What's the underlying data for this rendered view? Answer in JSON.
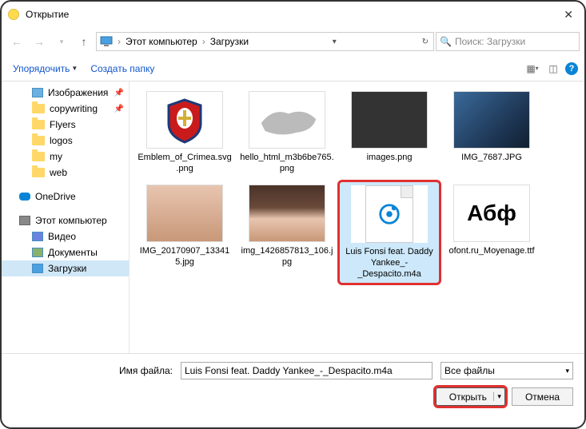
{
  "title": "Открытие",
  "breadcrumb": {
    "root": "Этот компьютер",
    "folder": "Загрузки"
  },
  "search": {
    "placeholder": "Поиск: Загрузки"
  },
  "toolbar": {
    "organize": "Упорядочить",
    "newfolder": "Создать папку"
  },
  "tree": {
    "images": "Изображения",
    "copywriting": "copywriting",
    "flyers": "Flyers",
    "logos": "logos",
    "my": "my",
    "web": "web",
    "onedrive": "OneDrive",
    "thispc": "Этот компьютер",
    "video": "Видео",
    "documents": "Документы",
    "downloads": "Загрузки"
  },
  "files": [
    {
      "name": "Emblem_of_Crimea.svg.png"
    },
    {
      "name": "hello_html_m3b6be765.png"
    },
    {
      "name": "images.png"
    },
    {
      "name": "IMG_7687.JPG"
    },
    {
      "name": "IMG_20170907_133415.jpg"
    },
    {
      "name": "img_1426857813_106.jpg"
    },
    {
      "name": "Luis Fonsi feat. Daddy Yankee_-_Despacito.m4a"
    },
    {
      "name": "ofont.ru_Moyenage.ttf"
    }
  ],
  "font_sample": "Абф",
  "bottom": {
    "label": "Имя файла:",
    "value": "Luis Fonsi feat. Daddy Yankee_-_Despacito.m4a",
    "filter": "Все файлы",
    "open": "Открыть",
    "cancel": "Отмена"
  }
}
